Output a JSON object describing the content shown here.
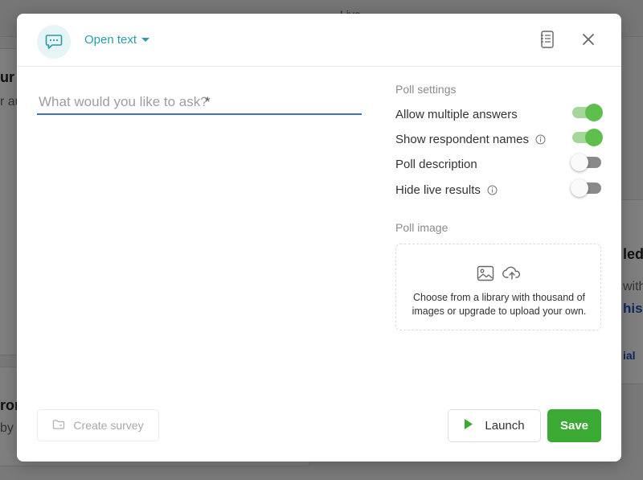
{
  "background": {
    "live_tab": "Live",
    "fragments": [
      "ur",
      "r au",
      "led",
      "with",
      "his",
      "ial",
      "ror",
      "by"
    ]
  },
  "modal": {
    "question_type": "Open text",
    "question_placeholder": "What would you like to ask?",
    "required_marker": "*",
    "settings": {
      "title": "Poll settings",
      "items": [
        {
          "label": "Allow multiple answers",
          "on": true,
          "info": false
        },
        {
          "label": "Show respondent names",
          "on": true,
          "info": true
        },
        {
          "label": "Poll description",
          "on": false,
          "info": false
        },
        {
          "label": "Hide live results",
          "on": false,
          "info": true
        }
      ]
    },
    "poll_image": {
      "title": "Poll image",
      "line1": "Choose from a library with thousand of",
      "line2": "images or upgrade to upload your own."
    },
    "buttons": {
      "create_survey": "Create survey",
      "launch": "Launch",
      "save": "Save"
    }
  },
  "colors": {
    "accent": "#2a9ca7",
    "toggle_on": "#5fbf4d",
    "save_bg": "#3aaa35",
    "input_underline": "#3a73c4"
  },
  "icons": {
    "type": "chat-bubble-icon",
    "notes": "notes-icon",
    "close": "close-icon",
    "info": "info-icon",
    "image": "image-icon",
    "upload": "cloud-upload-icon",
    "survey": "folder-icon",
    "launch": "play-icon"
  }
}
